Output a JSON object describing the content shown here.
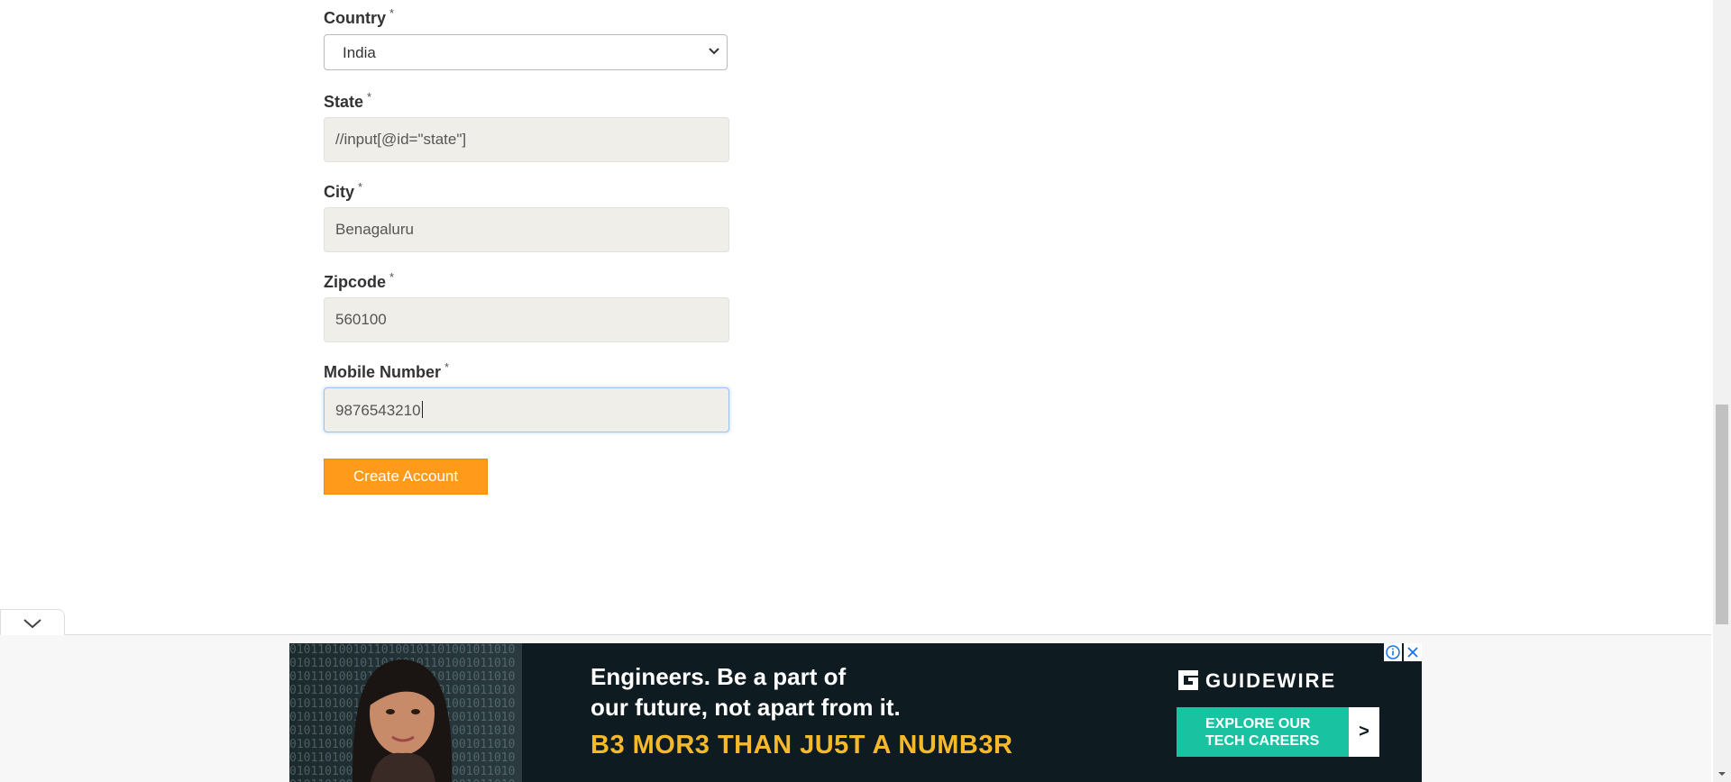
{
  "form": {
    "country": {
      "label": "Country",
      "required": "*",
      "selected": "India"
    },
    "state": {
      "label": "State",
      "required": "*",
      "value": "//input[@id=\"state\"]"
    },
    "city": {
      "label": "City",
      "required": "*",
      "value": "Benagaluru"
    },
    "zipcode": {
      "label": "Zipcode",
      "required": "*",
      "value": "560100"
    },
    "mobile": {
      "label": "Mobile Number",
      "required": "*",
      "value": "9876543210"
    },
    "submit_label": "Create Account"
  },
  "ad": {
    "headline_line1": "Engineers. Be a part of",
    "headline_line2": "our future, not apart from it.",
    "tagline": "B3 MOR3 THAN JU5T A NUMB3R",
    "brand": "GUIDEWIRE",
    "cta": "EXPLORE OUR TECH CAREERS",
    "cta_arrow": ">"
  },
  "colors": {
    "accent": "#ff9a1a",
    "input_bg": "#efeee9",
    "ad_bg": "#0e1b20",
    "ad_tagline": "#f5b92a",
    "ad_cta": "#19c3a2"
  }
}
